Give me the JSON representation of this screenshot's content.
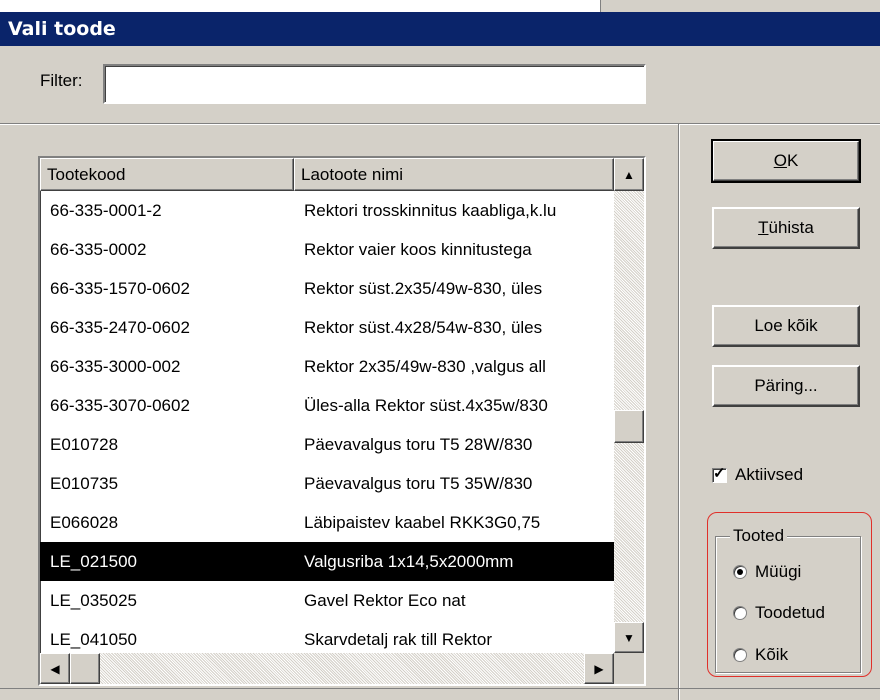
{
  "window": {
    "title": "Vali toode"
  },
  "filter": {
    "label": "Filter:",
    "value": "",
    "placeholder": ""
  },
  "table": {
    "columns": [
      "Tootekood",
      "Laotoote nimi"
    ],
    "rows": [
      {
        "code": "66-335-0001-2",
        "name": "Rektori trosskinnitus kaabliga,k.lu"
      },
      {
        "code": "66-335-0002",
        "name": "Rektor vaier koos kinnitustega"
      },
      {
        "code": "66-335-1570-0602",
        "name": "Rektor süst.2x35/49w-830, üles"
      },
      {
        "code": "66-335-2470-0602",
        "name": "Rektor süst.4x28/54w-830, üles"
      },
      {
        "code": "66-335-3000-002",
        "name": "Rektor 2x35/49w-830 ,valgus all"
      },
      {
        "code": "66-335-3070-0602",
        "name": "Üles-alla Rektor süst.4x35w/830"
      },
      {
        "code": "E010728",
        "name": "Päevavalgus toru T5 28W/830"
      },
      {
        "code": "E010735",
        "name": "Päevavalgus toru T5 35W/830"
      },
      {
        "code": "E066028",
        "name": "Läbipaistev kaabel RKK3G0,75"
      },
      {
        "code": "LE_021500",
        "name": "Valgusriba 1x14,5x2000mm",
        "selected": true
      },
      {
        "code": "LE_035025",
        "name": "Gavel Rektor Eco nat"
      },
      {
        "code": "LE_041050",
        "name": "Skarvdetalj rak till Rektor"
      }
    ],
    "vertical_scroll_fraction": 0.55
  },
  "buttons": {
    "ok": {
      "hotkey": "O",
      "rest": "K"
    },
    "cancel": {
      "hotkey": "T",
      "rest": "ühista"
    },
    "load_all": "Loe kõik",
    "query": "Päring..."
  },
  "active_checkbox": {
    "label": "Aktiivsed",
    "checked": true
  },
  "products_group": {
    "legend": "Tooted",
    "options": [
      {
        "label": "Müügi",
        "selected": true
      },
      {
        "label": "Toodetud",
        "selected": false
      },
      {
        "label": "Kõik",
        "selected": false
      }
    ]
  },
  "colors": {
    "title_bar": "#0a246a",
    "dialog_bg": "#d4d0c8",
    "selection": "#000000",
    "highlight_ring": "#e0302a"
  }
}
